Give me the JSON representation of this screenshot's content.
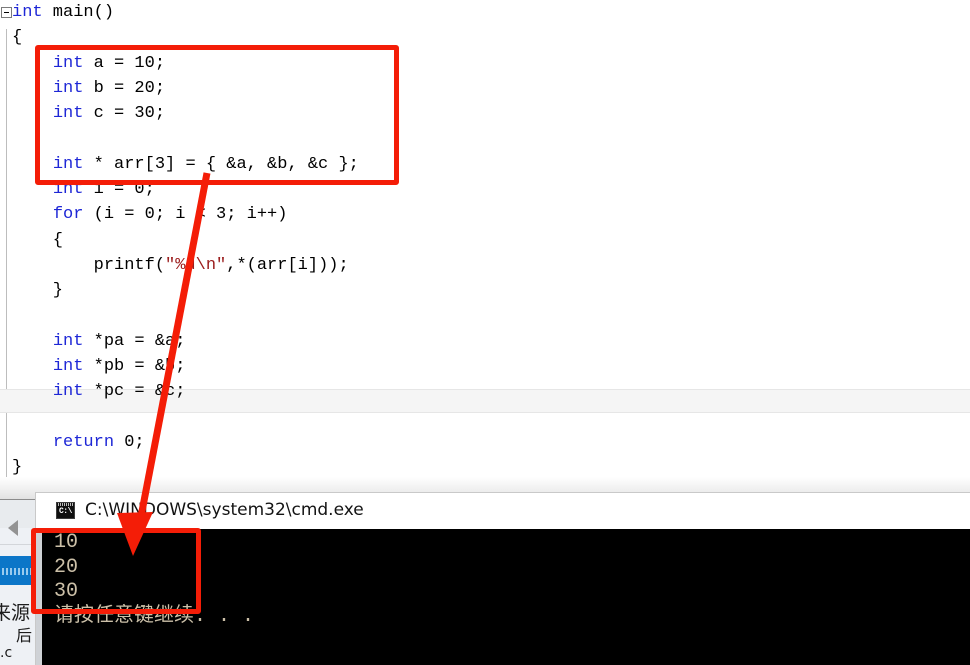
{
  "editor": {
    "language": "c",
    "keyword_color": "#1e27d6",
    "string_color": "#9b1c1c",
    "background": "#ffffff",
    "current_line_index": 14,
    "fold_marker": "collapse-minus",
    "lines": [
      [
        {
          "t": "int",
          "c": "kw"
        },
        {
          "t": " main()",
          "c": "pp"
        }
      ],
      [
        {
          "t": "{",
          "c": "pp"
        }
      ],
      [
        {
          "t": "    ",
          "c": "pp"
        },
        {
          "t": "int",
          "c": "kw"
        },
        {
          "t": " a = 10;",
          "c": "pp"
        }
      ],
      [
        {
          "t": "    ",
          "c": "pp"
        },
        {
          "t": "int",
          "c": "kw"
        },
        {
          "t": " b = 20;",
          "c": "pp"
        }
      ],
      [
        {
          "t": "    ",
          "c": "pp"
        },
        {
          "t": "int",
          "c": "kw"
        },
        {
          "t": " c = 30;",
          "c": "pp"
        }
      ],
      [
        {
          "t": "",
          "c": "pp"
        }
      ],
      [
        {
          "t": "    ",
          "c": "pp"
        },
        {
          "t": "int",
          "c": "kw"
        },
        {
          "t": " * arr[3] = { &a, &b, &c };",
          "c": "pp"
        }
      ],
      [
        {
          "t": "    ",
          "c": "pp"
        },
        {
          "t": "int",
          "c": "kw"
        },
        {
          "t": " i = 0;",
          "c": "pp"
        }
      ],
      [
        {
          "t": "    ",
          "c": "pp"
        },
        {
          "t": "for",
          "c": "kw"
        },
        {
          "t": " (i = 0; i < 3; i++)",
          "c": "pp"
        }
      ],
      [
        {
          "t": "    {",
          "c": "pp"
        }
      ],
      [
        {
          "t": "        printf(",
          "c": "pp"
        },
        {
          "t": "\"%d\\n\"",
          "c": "str"
        },
        {
          "t": ",*(arr[i]));",
          "c": "pp"
        }
      ],
      [
        {
          "t": "    }",
          "c": "pp"
        }
      ],
      [
        {
          "t": "",
          "c": "pp"
        }
      ],
      [
        {
          "t": "    ",
          "c": "pp"
        },
        {
          "t": "int",
          "c": "kw"
        },
        {
          "t": " *pa = &a;",
          "c": "pp"
        }
      ],
      [
        {
          "t": "    ",
          "c": "pp"
        },
        {
          "t": "int",
          "c": "kw"
        },
        {
          "t": " *pb = &b;",
          "c": "pp"
        }
      ],
      [
        {
          "t": "    ",
          "c": "pp"
        },
        {
          "t": "int",
          "c": "kw"
        },
        {
          "t": " *pc = &c;",
          "c": "pp"
        }
      ],
      [
        {
          "t": "",
          "c": "pp"
        }
      ],
      [
        {
          "t": "    ",
          "c": "pp"
        },
        {
          "t": "return",
          "c": "kw"
        },
        {
          "t": " 0;",
          "c": "pp"
        }
      ],
      [
        {
          "t": "}",
          "c": "pp"
        }
      ]
    ]
  },
  "left_panel": {
    "back_arrow_icon": "back-arrow-icon",
    "text_line_1": "来源",
    "text_line_2": "后",
    "text_line_3": ".c",
    "selection_color": "#0c76c8"
  },
  "console": {
    "title": "C:\\WINDOWS\\system32\\cmd.exe",
    "icon": "cmd-icon",
    "icon_text": "C:\\",
    "background": "#000000",
    "text_color": "#ccc0a8",
    "output_lines": [
      "10",
      "20",
      "30",
      "请按任意键继续. . ."
    ]
  },
  "annotations": {
    "color": "#f41d07",
    "rect_top": {
      "label": "array-declaration-highlight"
    },
    "rect_bottom": {
      "label": "console-output-highlight"
    },
    "arrow": {
      "label": "declaration-to-output-arrow"
    }
  }
}
